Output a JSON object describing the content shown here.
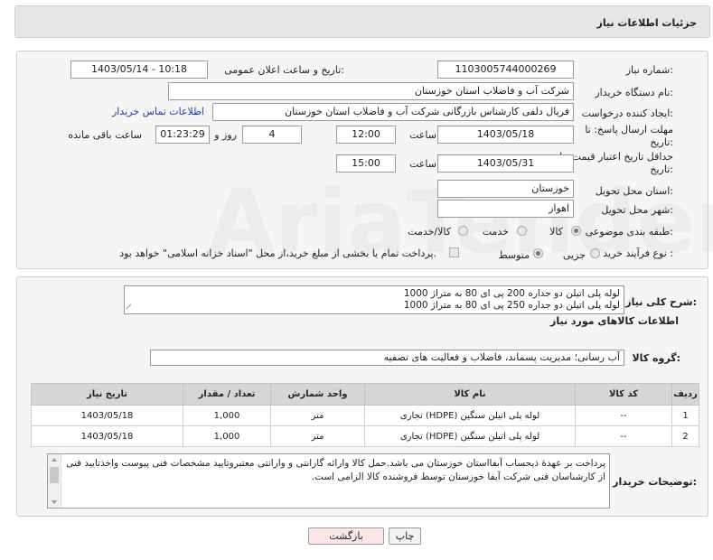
{
  "header": {
    "title": "جزئیات اطلاعات نیاز"
  },
  "watermark": "AriaTender.net",
  "form": {
    "need_number_label": "شماره نیاز:",
    "need_number": "1103005744000269",
    "announce_label": "تاریخ و ساعت اعلان عمومی:",
    "announce_value": "1403/05/14 - 10:18",
    "buyer_org_label": "نام دستگاه خریدار:",
    "buyer_org": "شرکت آب و فاضلاب استان خوزستان",
    "requester_label": "ایجاد کننده درخواست:",
    "requester": "فریال دلفی کارشناس بازرگانی شرکت آب و فاضلاب استان خوزستان",
    "contact_link": "اطلاعات تماس خریدار",
    "deadline_label": "مهلت ارسال پاسخ: تا تاریخ:",
    "deadline_date": "1403/05/18",
    "time_label": "ساعت",
    "deadline_time": "12:00",
    "days_value": "4",
    "days_label": "روز و",
    "remaining_value": "01:23:29",
    "remaining_label": "ساعت باقی مانده",
    "price_valid_label": "حداقل تاریخ اعتبار قیمت: تا تاریخ:",
    "price_valid_date": "1403/05/31",
    "price_valid_time": "15:00",
    "province_label": "استان محل تحویل:",
    "province": "خوزستان",
    "city_label": "شهر محل تحویل:",
    "city": "اهواز",
    "category_label": "طبقه بندی موضوعی:",
    "cat_goods": "کالا",
    "cat_service": "خدمت",
    "cat_goods_service": "کالا/خدمت",
    "process_label": "نوع فرآیند خرید :",
    "proc_minor": "جزیی",
    "proc_medium": "متوسط",
    "payment_note": "پرداخت تمام یا بخشی از مبلغ خرید،از محل \"اسناد خزانه اسلامی\" خواهد بود."
  },
  "summary": {
    "label": "شرح کلی نیاز:",
    "line1": "لوله پلی اتیلن دو جداره 200 پی ای 80 به متراژ 1000",
    "line2": "لوله پلی اتیلن دو جداره 250 پی ای 80 به متراژ 1000"
  },
  "goods_info_title": "اطلاعات کالاهای مورد نیاز",
  "goods_group": {
    "label": "گروه کالا:",
    "value": "آب رسانی؛ مدیریت پسماند، فاضلاب و فعالیت های تصفیه"
  },
  "table": {
    "headers": [
      "ردیف",
      "کد کالا",
      "نام کالا",
      "واحد شمارش",
      "تعداد / مقدار",
      "تاریخ نیاز"
    ],
    "rows": [
      [
        "1",
        "--",
        "لوله پلی اتیلن سنگین (HDPE) تجاری",
        "متر",
        "1,000",
        "1403/05/18"
      ],
      [
        "2",
        "--",
        "لوله پلی اتیلن سنگین (HDPE) تجاری",
        "متر",
        "1,000",
        "1403/05/18"
      ]
    ]
  },
  "buyer_notes": {
    "label": "توضیحات خریدار:",
    "text": "پرداخت بر عهدهٔ ذیحساب آبفااستان خوزستان می باشد.حمل کالا وارائه گارانتی و وارانتی معتبروتایید مشخصات فنی پیوست واخذتایید فنی از کارشناسان فنی شرکت آبفا خوزستان توسط فروشنده کالا الزامی است."
  },
  "buttons": {
    "print": "چاپ",
    "back": "بازگشت"
  }
}
